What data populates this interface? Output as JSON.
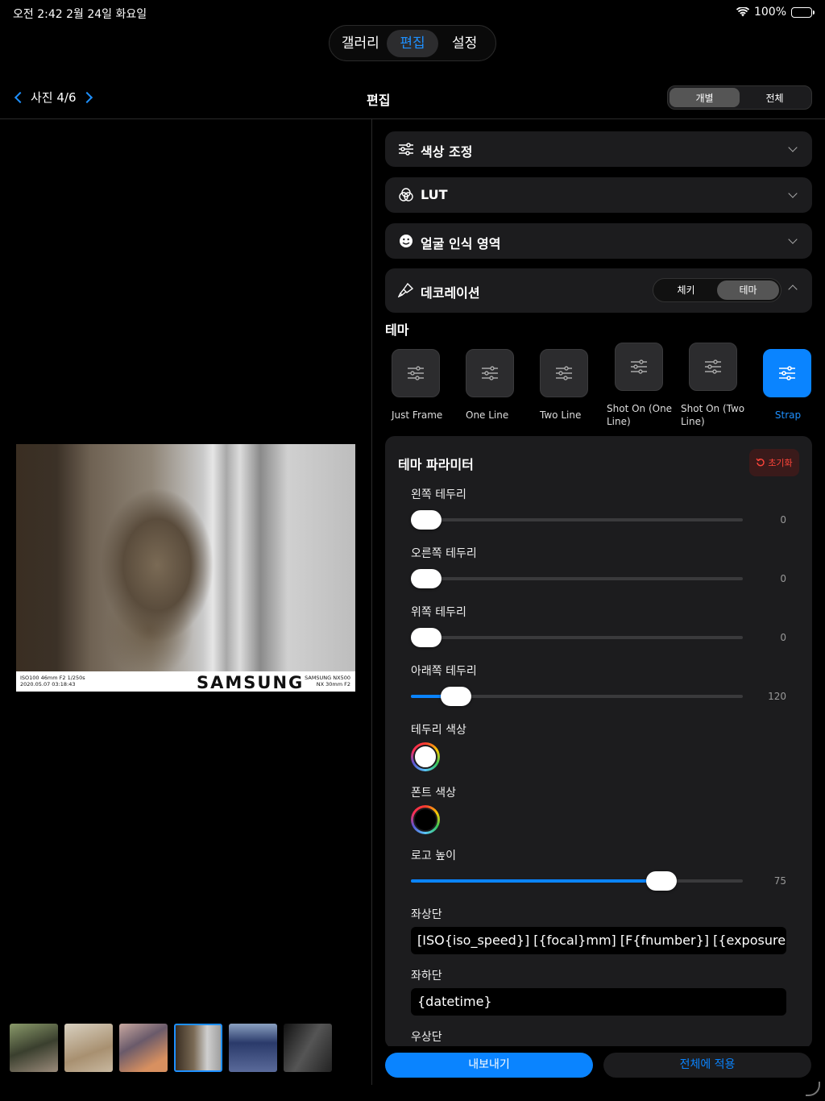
{
  "status": {
    "time": "오전 2:42   2월 24일 화요일",
    "battery": "100%"
  },
  "top_tabs": [
    {
      "label": "갤러리",
      "active": false
    },
    {
      "label": "편집",
      "active": true
    },
    {
      "label": "설정",
      "active": false
    }
  ],
  "nav": {
    "photo_counter": "사진 4/6",
    "title": "편집"
  },
  "scope_toggle": {
    "individual": "개별",
    "all": "전체"
  },
  "photo": {
    "left_line1": "ISO100 46mm F2 1/250s",
    "left_line2": "2020.05.07 03:18:43",
    "logo": "SAMSUNG",
    "right_line1": "SAMSUNG NX500",
    "right_line2": "NX 30mm F2"
  },
  "sections": {
    "color_adjust": "색상 조정",
    "lut": "LUT",
    "face_area": "얼굴 인식 영역",
    "decoration": "데코레이션"
  },
  "decoration_toggle": {
    "left": "체키",
    "right": "테마"
  },
  "theme": {
    "title": "테마",
    "items": [
      {
        "name": "Just Frame",
        "active": false
      },
      {
        "name": "One Line",
        "active": false
      },
      {
        "name": "Two Line",
        "active": false
      },
      {
        "name": "Shot On (One Line)",
        "active": false
      },
      {
        "name": "Shot On (Two Line)",
        "active": false
      },
      {
        "name": "Strap",
        "active": true
      }
    ]
  },
  "params": {
    "title": "테마 파라미터",
    "reset": "초기화",
    "left_border": {
      "label": "왼쪽 테두리",
      "value": "0",
      "fraction": 0
    },
    "right_border": {
      "label": "오른쪽 테두리",
      "value": "0",
      "fraction": 0
    },
    "top_border": {
      "label": "위쪽 테두리",
      "value": "0",
      "fraction": 0
    },
    "bottom_border": {
      "label": "아래쪽 테두리",
      "value": "120",
      "fraction": 0.1
    },
    "border_color": {
      "label": "테두리 색상",
      "color": "#ffffff"
    },
    "font_color": {
      "label": "폰트 색상",
      "color": "#000000"
    },
    "logo_height": {
      "label": "로고 높이",
      "value": "75",
      "fraction": 0.78
    },
    "top_left": {
      "label": "좌상단",
      "value": "[ISO{iso_speed}] [{focal}mm] [F{fnumber}] [{exposure}s]"
    },
    "bottom_left": {
      "label": "좌하단",
      "value": "{datetime}"
    },
    "top_right": {
      "label": "우상단"
    }
  },
  "buttons": {
    "export": "내보내기",
    "apply_all": "전체에 적용"
  },
  "colors": {
    "accent": "#0a84ff",
    "panel": "#1c1c1e",
    "reset": "#ff453a"
  }
}
